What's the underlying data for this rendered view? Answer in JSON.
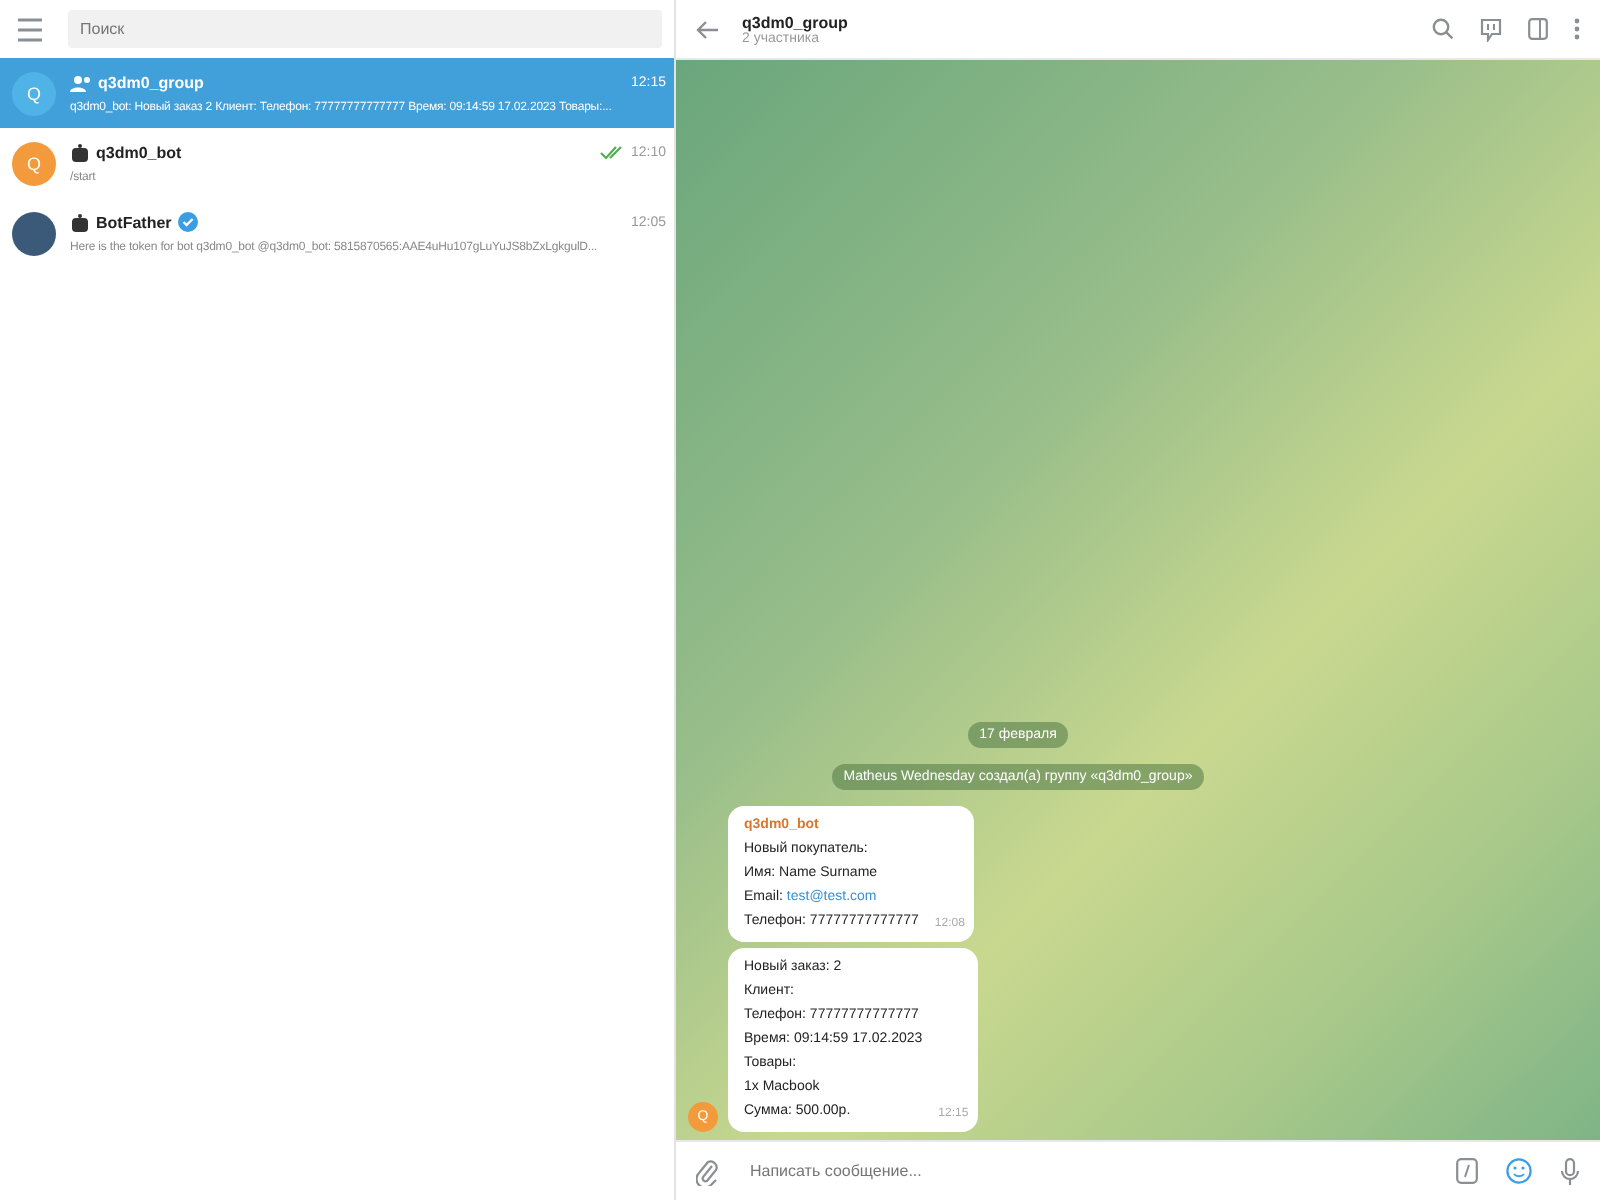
{
  "sidebar": {
    "search": {
      "placeholder": "Поиск"
    },
    "chats": [
      {
        "kind": "group",
        "avatar_letter": "Q",
        "color": "#4fb3e8",
        "name": "q3dm0_group",
        "time": "12:15",
        "preview": "q3dm0_bot: Новый заказ 2 Клиент: Телефон: 77777777777777 Время: 09:14:59 17.02.2023 Товары:...",
        "selected": true,
        "read": false,
        "verified": false
      },
      {
        "kind": "bot",
        "avatar_letter": "Q",
        "color": "#f39a3c",
        "name": "q3dm0_bot",
        "time": "12:10",
        "preview": "/start",
        "selected": false,
        "read": true,
        "verified": false
      },
      {
        "kind": "bot",
        "color": "#3b5a7a",
        "name": "BotFather",
        "time": "12:05",
        "preview": "Here is the token for bot q3dm0_bot @q3dm0_bot: 5815870565:AAE4uHu107gLuYuJS8bZxLgkgulD...",
        "selected": false,
        "read": false,
        "verified": true
      }
    ]
  },
  "chat": {
    "title": "q3dm0_group",
    "subtitle": "2 участника",
    "date": "17 февраля",
    "service": "Matheus Wednesday создал(а) группу «q3dm0_group»",
    "messages": [
      {
        "sender": "q3dm0_bot",
        "time": "12:08",
        "lines": [
          {
            "text": "Новый покупатель:"
          },
          {
            "text": "Имя: Name Surname"
          },
          {
            "text": "Email:",
            "link": "test@test.com"
          },
          {
            "text": "Телефон: 77777777777777"
          }
        ]
      },
      {
        "time": "12:15",
        "lines": [
          {
            "text": "Новый заказ: 2"
          },
          {
            "text": "Клиент:"
          },
          {
            "text": "Телефон: 77777777777777"
          },
          {
            "text": "Время: 09:14:59 17.02.2023"
          },
          {
            "text": "Товары:"
          },
          {
            "text": "1x Macbook"
          },
          {
            "text": "Сумма: 500.00р."
          }
        ]
      }
    ],
    "sender_avatar_letter": "Q",
    "composer": {
      "placeholder": "Написать сообщение..."
    }
  }
}
